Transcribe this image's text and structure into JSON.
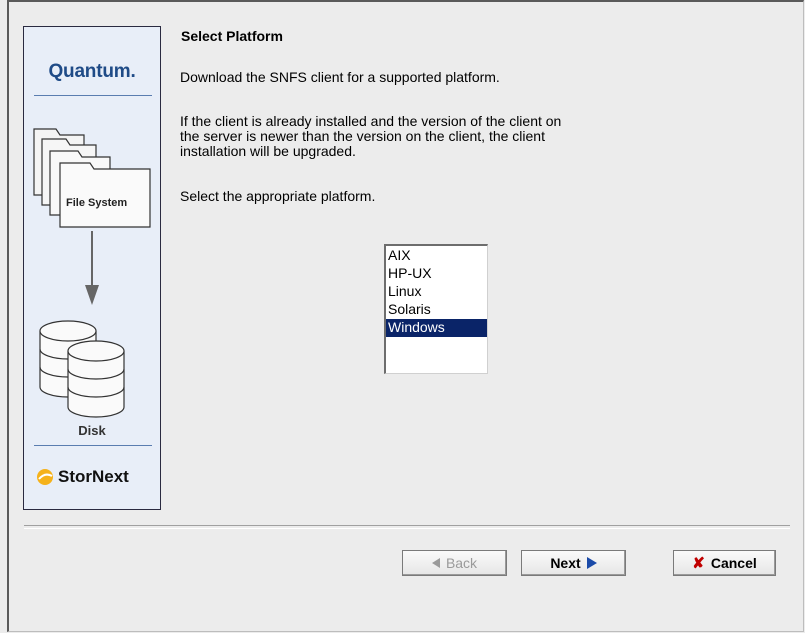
{
  "banner": {
    "brand": "Quantum.",
    "fs_label": "File System",
    "disk_label": "Disk",
    "product": "StorNext"
  },
  "page": {
    "title": "Select Platform",
    "intro": "Download the SNFS client for a supported platform.",
    "note": "If the client is already installed and the version of the client on\nthe server is newer than the version on the client, the client\ninstallation will be upgraded.",
    "prompt": "Select the appropriate platform."
  },
  "platforms": {
    "items": [
      "AIX",
      "HP-UX",
      "Linux",
      "Solaris",
      "Windows"
    ],
    "selected": "Windows"
  },
  "buttons": {
    "back": "Back",
    "next": "Next",
    "cancel": "Cancel"
  },
  "colors": {
    "selection": "#0a2468",
    "brand": "#1f4b87",
    "banner_bg": "#e8eef8"
  }
}
